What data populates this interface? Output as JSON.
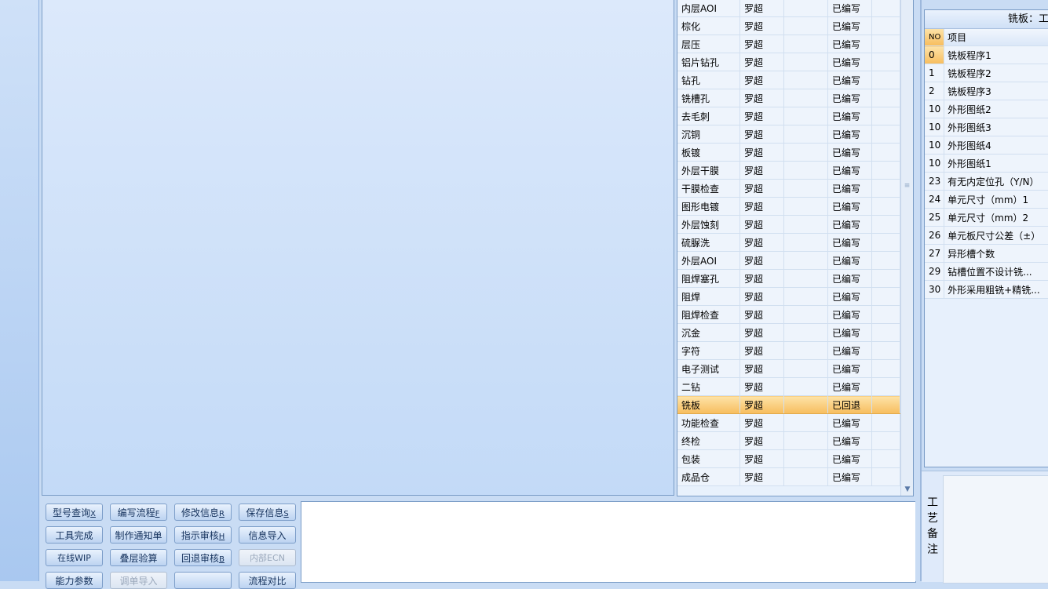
{
  "process_table": {
    "rows": [
      {
        "step": "内层AOI",
        "person": "罗超",
        "blank": "",
        "status": "已编写"
      },
      {
        "step": "棕化",
        "person": "罗超",
        "blank": "",
        "status": "已编写"
      },
      {
        "step": "层压",
        "person": "罗超",
        "blank": "",
        "status": "已编写"
      },
      {
        "step": "铝片钻孔",
        "person": "罗超",
        "blank": "",
        "status": "已编写"
      },
      {
        "step": "钻孔",
        "person": "罗超",
        "blank": "",
        "status": "已编写"
      },
      {
        "step": "铣槽孔",
        "person": "罗超",
        "blank": "",
        "status": "已编写"
      },
      {
        "step": "去毛刺",
        "person": "罗超",
        "blank": "",
        "status": "已编写"
      },
      {
        "step": "沉铜",
        "person": "罗超",
        "blank": "",
        "status": "已编写"
      },
      {
        "step": "板镀",
        "person": "罗超",
        "blank": "",
        "status": "已编写"
      },
      {
        "step": "外层干膜",
        "person": "罗超",
        "blank": "",
        "status": "已编写"
      },
      {
        "step": "干膜检查",
        "person": "罗超",
        "blank": "",
        "status": "已编写"
      },
      {
        "step": "图形电镀",
        "person": "罗超",
        "blank": "",
        "status": "已编写"
      },
      {
        "step": "外层蚀刻",
        "person": "罗超",
        "blank": "",
        "status": "已编写"
      },
      {
        "step": "硫脲洗",
        "person": "罗超",
        "blank": "",
        "status": "已编写"
      },
      {
        "step": "外层AOI",
        "person": "罗超",
        "blank": "",
        "status": "已编写"
      },
      {
        "step": "阻焊塞孔",
        "person": "罗超",
        "blank": "",
        "status": "已编写"
      },
      {
        "step": "阻焊",
        "person": "罗超",
        "blank": "",
        "status": "已编写"
      },
      {
        "step": "阻焊检查",
        "person": "罗超",
        "blank": "",
        "status": "已编写"
      },
      {
        "step": "沉金",
        "person": "罗超",
        "blank": "",
        "status": "已编写"
      },
      {
        "step": "字符",
        "person": "罗超",
        "blank": "",
        "status": "已编写"
      },
      {
        "step": "电子测试",
        "person": "罗超",
        "blank": "",
        "status": "已编写"
      },
      {
        "step": "二钻",
        "person": "罗超",
        "blank": "",
        "status": "已编写"
      },
      {
        "step": "铣板",
        "person": "罗超",
        "blank": "",
        "status": "已回退"
      },
      {
        "step": "功能检查",
        "person": "罗超",
        "blank": "",
        "status": "已编写"
      },
      {
        "step": "终检",
        "person": "罗超",
        "blank": "",
        "status": "已编写"
      },
      {
        "step": "包装",
        "person": "罗超",
        "blank": "",
        "status": "已编写"
      },
      {
        "step": "成品仓",
        "person": "罗超",
        "blank": "",
        "status": "已编写"
      }
    ],
    "selected_index": 22
  },
  "buttons": {
    "query": {
      "label": "型号查询",
      "key": "X"
    },
    "edit_flow": {
      "label": "编写流程",
      "key": "F"
    },
    "modify_info": {
      "label": "修改信息",
      "key": "R"
    },
    "save_info": {
      "label": "保存信息",
      "key": "S"
    },
    "tool_done": {
      "label": "工具完成"
    },
    "make_notice": {
      "label": "制作通知单"
    },
    "instruct_review": {
      "label": "指示审核",
      "key": "H"
    },
    "info_import": {
      "label": "信息导入"
    },
    "online_wip": {
      "label": "在线WIP"
    },
    "stack_check": {
      "label": "叠层验算"
    },
    "rollback_review": {
      "label": "回退审核",
      "key": "B"
    },
    "internal_ecn": {
      "label": "内部ECN"
    },
    "capacity_param": {
      "label": "能力参数"
    },
    "order_import": {
      "label": "调单导入"
    },
    "blank": {
      "label": ""
    },
    "flow_compare": {
      "label": "流程对比"
    }
  },
  "mill_panel": {
    "title": "铣板：工",
    "header_no": "NO",
    "header_item": "项目",
    "rows": [
      {
        "no": "0",
        "item": "铣板程序1"
      },
      {
        "no": "1",
        "item": "铣板程序2"
      },
      {
        "no": "2",
        "item": "铣板程序3"
      },
      {
        "no": "10",
        "item": "外形图纸2"
      },
      {
        "no": "10",
        "item": "外形图纸3"
      },
      {
        "no": "10",
        "item": "外形图纸4"
      },
      {
        "no": "10",
        "item": "外形图纸1"
      },
      {
        "no": "23",
        "item": "有无内定位孔（Y/N）"
      },
      {
        "no": "24",
        "item": "单元尺寸（mm）1"
      },
      {
        "no": "25",
        "item": "单元尺寸（mm）2"
      },
      {
        "no": "26",
        "item": "单元板尺寸公差（±）"
      },
      {
        "no": "27",
        "item": "异形槽个数"
      },
      {
        "no": "29",
        "item": "钻槽位置不设计铣..."
      },
      {
        "no": "30",
        "item": "外形采用粗铣+精铣..."
      }
    ]
  },
  "remarks": {
    "label": "工艺备注",
    "chars": [
      "工",
      "艺",
      "备",
      "注"
    ]
  }
}
